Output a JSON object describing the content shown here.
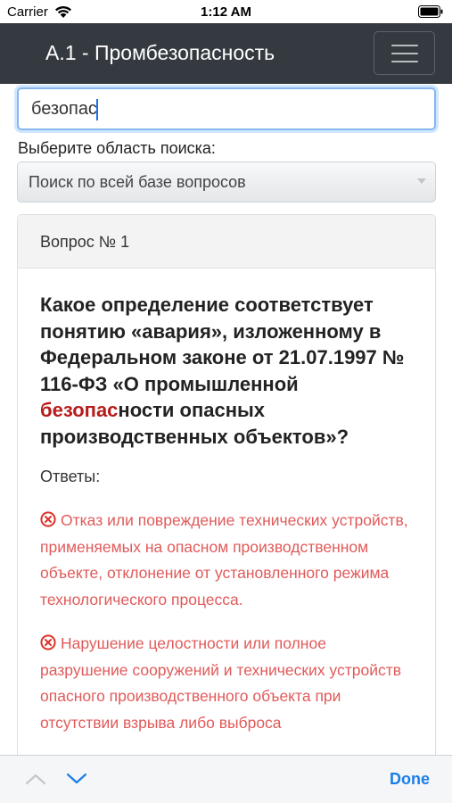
{
  "status_bar": {
    "carrier": "Carrier",
    "time": "1:12 AM",
    "wifi_icon": "wifi-icon",
    "battery_icon": "battery-icon"
  },
  "navbar": {
    "title": "А.1 - Промбезопасность",
    "menu_icon": "hamburger-menu-icon",
    "background": "#343a40"
  },
  "search": {
    "value": "безопас"
  },
  "search_area": {
    "label": "Выберите область поиска:",
    "selected": "Поиск по всей базе вопросов"
  },
  "question": {
    "header": "Вопрос № 1",
    "text_before": "Какое определение соответствует понятию «авария», изложенному в Федеральном законе от 21.07.1997 № 116-ФЗ «О промышленной ",
    "text_highlight": "безопас",
    "text_after": "ности опасных производственных объектов»?",
    "highlight_color": "#b51c1c",
    "answers_label": "Ответы:",
    "answers": [
      {
        "icon": "x-circle-icon",
        "text": "Отказ или повреждение технических устройств, применяемых на опасном производственном объекте, отклонение от установленного режима технологического процесса."
      },
      {
        "icon": "x-circle-icon",
        "text": "Нарушение целостности или полное разрушение сооружений и технических устройств опасного производственного объекта при отсутствии взрыва либо выброса"
      }
    ],
    "answer_color": "#e05a5a"
  },
  "keyboard_toolbar": {
    "done_label": "Done",
    "prev_icon": "chevron-up-icon",
    "next_icon": "chevron-down-icon",
    "accent": "#1a7ee8"
  }
}
